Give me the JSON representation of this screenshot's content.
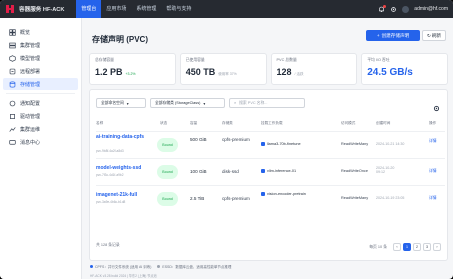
{
  "app": {
    "brand": "容器服务 HF-ACK",
    "nav": [
      "管理台",
      "应用市场",
      "系统管理",
      "帮助与支持"
    ],
    "user": "admin@hf.com"
  },
  "sidebar": {
    "items": [
      {
        "label": "概览",
        "icon": "overview-icon"
      },
      {
        "label": "集群管理",
        "icon": "cluster-icon"
      },
      {
        "label": "模型管理",
        "icon": "model-icon"
      },
      {
        "label": "远程部署",
        "icon": "deploy-icon"
      },
      {
        "label": "存储管理",
        "icon": "storage-icon",
        "active": true
      },
      {
        "label": "通知配置",
        "icon": "notify-icon"
      },
      {
        "label": "驱动管理",
        "icon": "driver-icon"
      },
      {
        "label": "集群运维",
        "icon": "ops-icon"
      },
      {
        "label": "消息中心",
        "icon": "message-icon"
      }
    ]
  },
  "page": {
    "title": "存储声明 (PVC)",
    "create": "创建存储声明",
    "refresh": "刷新"
  },
  "stats": [
    {
      "label": "总存储容量",
      "value": "1.2 PB",
      "sub": "+3.2%"
    },
    {
      "label": "已使用容量",
      "value": "450 TB",
      "sub": "使用率 37%"
    },
    {
      "label": "PVC 总数量",
      "value": "128",
      "sub": "/ 活跃"
    },
    {
      "label": "平均 I/O 吞吐",
      "value": "24.5 GB/s",
      "sub": ""
    }
  ],
  "filters": {
    "ns": "全部命名空间",
    "sc": "全部存储类 (StorageClass)",
    "search_placeholder": "搜索 PVC 名称..."
  },
  "table": {
    "headers": [
      "名称",
      "状态",
      "容量",
      "存储类",
      "挂载工作负载",
      "访问模式",
      "创建时间",
      "操作"
    ],
    "rows": [
      {
        "name": "ai-training-data-cpfs",
        "id": "pvc-9b8f-4a2f-a8d3",
        "status": "Bound",
        "cap": "500 GiB",
        "sc": "cpfs-premium",
        "bind": "llama3-70b-finetune",
        "mode": "ReadWriteMany",
        "time": "2024-10-21 14:30",
        "op": "详情"
      },
      {
        "name": "model-weights-ssd",
        "id": "pvc-7f3c-4d1f-a9b2",
        "status": "Bound",
        "cap": "100 GiB",
        "sc": "disk-ssd",
        "bind": "vllm-inference-01",
        "mode": "ReadWriteOnce",
        "time": "2024-10-20 09:12",
        "op": "详情"
      },
      {
        "name": "imagenet-21k-full",
        "id": "pvc-3a9e-4b6c-b1d8",
        "status": "Bound",
        "cap": "2.5 TiB",
        "sc": "cpfs-premium",
        "bind": "vision-encoder-pretrain",
        "mode": "ReadWriteMany",
        "time": "2024-10-19 23:05",
        "op": "详情"
      }
    ]
  },
  "footer": {
    "total": "共 128 条记录",
    "per_page": "每页 10 条",
    "pages": [
      "1",
      "2",
      "3"
    ]
  },
  "legend": [
    {
      "label": "CPFS：并行文件系统 (适用 AI 训练)",
      "color": "#2563eb"
    },
    {
      "label": "ESSD：数据库云盘，适用高性能单节点推理",
      "color": "#9ca3af"
    }
  ],
  "version": "HF-ACK v3.28 build 2024 | 华东2 (上海) 节点池"
}
